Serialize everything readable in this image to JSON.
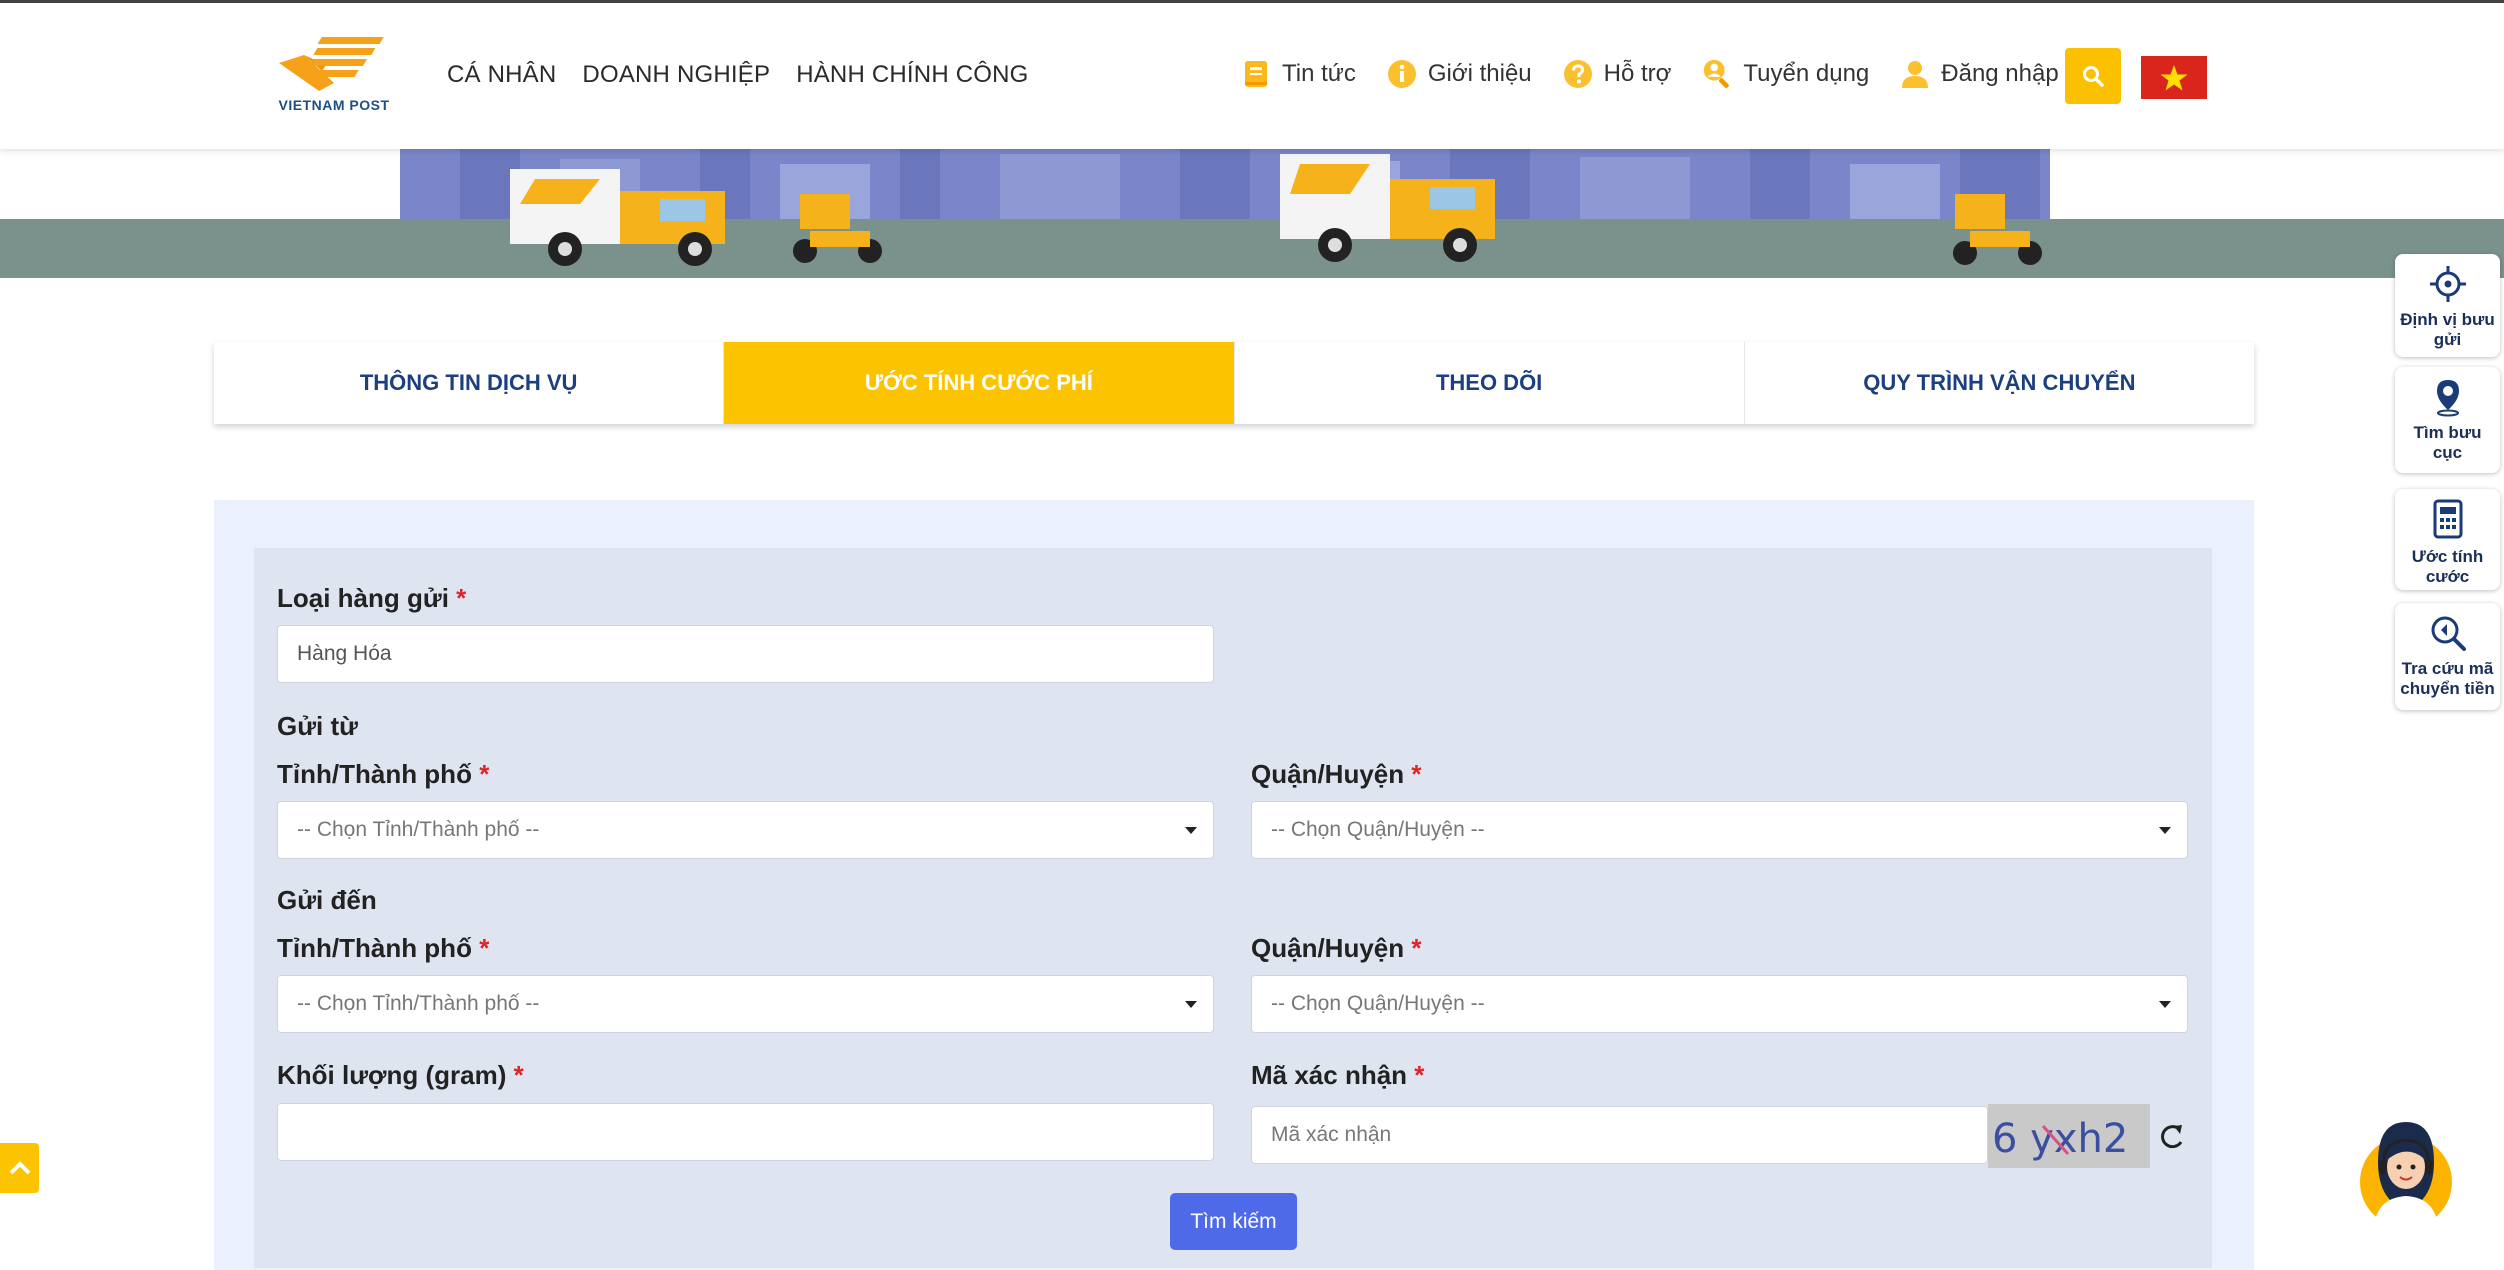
{
  "header": {
    "logo_text": "VIETNAM POST",
    "main_nav": [
      "CÁ NHÂN",
      "DOANH NGHIỆP",
      "HÀNH CHÍNH CÔNG"
    ],
    "sub_nav": {
      "news": "Tin tức",
      "about": "Giới thiệu",
      "support": "Hỗ trợ",
      "careers": "Tuyển dụng",
      "login": "Đăng nhập"
    }
  },
  "tabs": [
    {
      "label": "THÔNG TIN DỊCH VỤ",
      "active": false
    },
    {
      "label": "ƯỚC TÍNH CƯỚC PHÍ",
      "active": true
    },
    {
      "label": "THEO DÕI",
      "active": false
    },
    {
      "label": "QUY TRÌNH VẬN CHUYỂN",
      "active": false
    }
  ],
  "form": {
    "goods_type_label": "Loại hàng gửi",
    "goods_type_value": "Hàng Hóa",
    "from_label": "Gửi từ",
    "to_label": "Gửi đến",
    "province_label": "Tỉnh/Thành phố",
    "district_label": "Quận/Huyện",
    "province_placeholder": "-- Chọn Tỉnh/Thành phố --",
    "district_placeholder": "-- Chọn Quận/Huyện --",
    "weight_label": "Khối lượng (gram)",
    "weight_value": "",
    "captcha_label": "Mã xác nhận",
    "captcha_placeholder": "Mã xác nhận",
    "captcha_text": "6 yxh2",
    "required_mark": "*",
    "submit_label": "Tìm kiếm"
  },
  "side_widgets": [
    {
      "label": "Định vị bưu gửi",
      "icon": "crosshair-icon"
    },
    {
      "label": "Tìm bưu cục",
      "icon": "location-pin-icon"
    },
    {
      "label": "Ước tính cước",
      "icon": "calculator-icon"
    },
    {
      "label": "Tra cứu mã chuyển tiền",
      "icon": "search-money-icon"
    }
  ],
  "colors": {
    "accent": "#fcc300",
    "nav_blue": "#1c3f80",
    "button": "#4f6ae8",
    "required": "#e02424"
  }
}
